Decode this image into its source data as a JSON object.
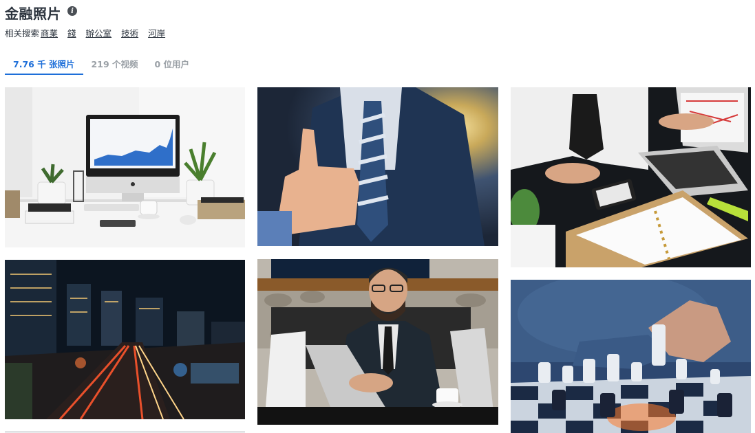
{
  "header": {
    "title": "金融照片"
  },
  "related": {
    "label": "相关搜索",
    "links": [
      "商業",
      "錢",
      "辦公室",
      "技術",
      "河岸"
    ]
  },
  "tabs": [
    {
      "label": "7.76 千 张照片",
      "active": true
    },
    {
      "label": "219 个视频",
      "active": false
    },
    {
      "label": "0 位用户",
      "active": false
    }
  ],
  "colors": {
    "accent": "#1e6fd9",
    "text": "#2c343e",
    "muted": "#9aa0a6"
  },
  "photos": [
    {
      "subject": "desk-imac-chart"
    },
    {
      "subject": "thumbs-up-businessman"
    },
    {
      "subject": "office-meeting-laptop"
    },
    {
      "subject": "night-city-street"
    },
    {
      "subject": "man-with-laptop-phone"
    },
    {
      "subject": "chess-game"
    }
  ]
}
